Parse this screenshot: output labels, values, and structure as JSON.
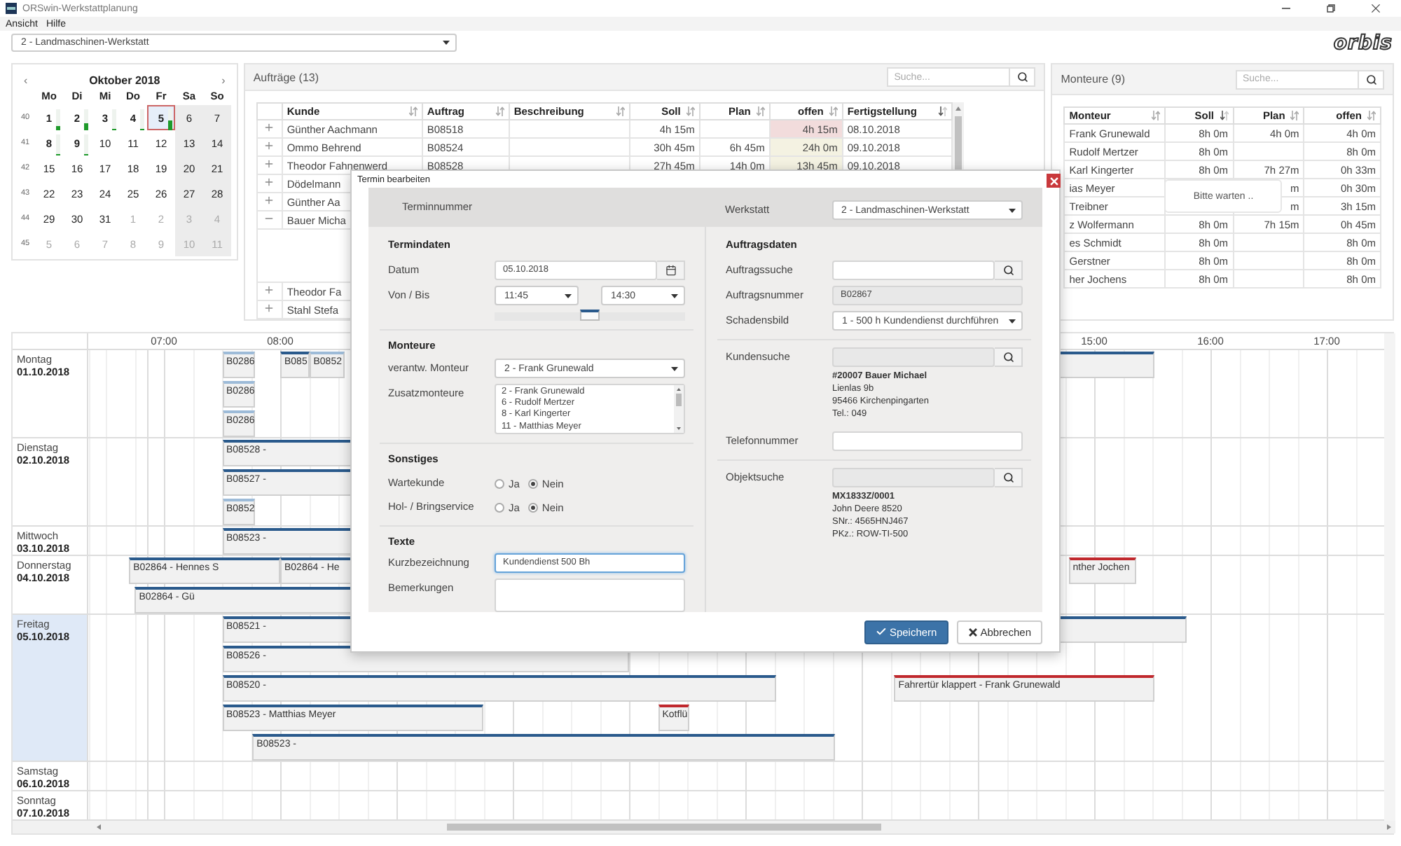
{
  "window": {
    "title": "ORSwin-Werkstattplanung"
  },
  "menu": [
    "Ansicht",
    "Hilfe"
  ],
  "workshop_select": {
    "value": "2 - Landmaschinen-Werkstatt"
  },
  "logo": "orbis",
  "calendar": {
    "prev": "‹",
    "month": "Oktober 2018",
    "next": "›",
    "weekdays": [
      "Mo",
      "Di",
      "Mi",
      "Do",
      "Fr",
      "Sa",
      "So"
    ],
    "weeks": [
      {
        "number": "40",
        "days": [
          {
            "label": "1",
            "muted": false,
            "has_appointments": true,
            "selected": false,
            "level": 0.2
          },
          {
            "label": "2",
            "muted": false,
            "has_appointments": true,
            "selected": false,
            "level": 0.35
          },
          {
            "label": "3",
            "muted": false,
            "has_appointments": true,
            "selected": false,
            "level": 0.07
          },
          {
            "label": "4",
            "muted": false,
            "has_appointments": true,
            "selected": false,
            "level": 0.07
          },
          {
            "label": "5",
            "muted": false,
            "has_appointments": true,
            "selected": true,
            "level": 0.5
          },
          {
            "label": "6",
            "muted": false,
            "has_appointments": false,
            "selected": false
          },
          {
            "label": "7",
            "muted": false,
            "has_appointments": false,
            "selected": false
          }
        ]
      },
      {
        "number": "41",
        "days": [
          {
            "label": "8",
            "muted": false,
            "has_appointments": true,
            "selected": false,
            "level": 0.07
          },
          {
            "label": "9",
            "muted": false,
            "has_appointments": true,
            "selected": false,
            "level": 0.07
          },
          {
            "label": "10",
            "muted": false,
            "has_appointments": false,
            "selected": false
          },
          {
            "label": "11",
            "muted": false,
            "has_appointments": false,
            "selected": false
          },
          {
            "label": "12",
            "muted": false,
            "has_appointments": false,
            "selected": false
          },
          {
            "label": "13",
            "muted": false,
            "has_appointments": false,
            "selected": false
          },
          {
            "label": "14",
            "muted": false,
            "has_appointments": false,
            "selected": false
          }
        ]
      },
      {
        "number": "42",
        "days": [
          {
            "label": "15",
            "muted": false,
            "has_appointments": false,
            "selected": false
          },
          {
            "label": "16",
            "muted": false,
            "has_appointments": false,
            "selected": false
          },
          {
            "label": "17",
            "muted": false,
            "has_appointments": false,
            "selected": false
          },
          {
            "label": "18",
            "muted": false,
            "has_appointments": false,
            "selected": false
          },
          {
            "label": "19",
            "muted": false,
            "has_appointments": false,
            "selected": false
          },
          {
            "label": "20",
            "muted": false,
            "has_appointments": false,
            "selected": false
          },
          {
            "label": "21",
            "muted": false,
            "has_appointments": false,
            "selected": false
          }
        ]
      },
      {
        "number": "43",
        "days": [
          {
            "label": "22",
            "muted": false,
            "has_appointments": false,
            "selected": false
          },
          {
            "label": "23",
            "muted": false,
            "has_appointments": false,
            "selected": false
          },
          {
            "label": "24",
            "muted": false,
            "has_appointments": false,
            "selected": false
          },
          {
            "label": "25",
            "muted": false,
            "has_appointments": false,
            "selected": false
          },
          {
            "label": "26",
            "muted": false,
            "has_appointments": false,
            "selected": false
          },
          {
            "label": "27",
            "muted": false,
            "has_appointments": false,
            "selected": false
          },
          {
            "label": "28",
            "muted": false,
            "has_appointments": false,
            "selected": false
          }
        ]
      },
      {
        "number": "44",
        "days": [
          {
            "label": "29",
            "muted": false,
            "has_appointments": false,
            "selected": false
          },
          {
            "label": "30",
            "muted": false,
            "has_appointments": false,
            "selected": false
          },
          {
            "label": "31",
            "muted": false,
            "has_appointments": false,
            "selected": false
          },
          {
            "label": "1",
            "muted": true,
            "has_appointments": false,
            "selected": false
          },
          {
            "label": "2",
            "muted": true,
            "has_appointments": false,
            "selected": false
          },
          {
            "label": "3",
            "muted": true,
            "has_appointments": false,
            "selected": false
          },
          {
            "label": "4",
            "muted": true,
            "has_appointments": false,
            "selected": false
          }
        ]
      },
      {
        "number": "45",
        "days": [
          {
            "label": "5",
            "muted": true,
            "has_appointments": false,
            "selected": false
          },
          {
            "label": "6",
            "muted": true,
            "has_appointments": false,
            "selected": false
          },
          {
            "label": "7",
            "muted": true,
            "has_appointments": false,
            "selected": false
          },
          {
            "label": "8",
            "muted": true,
            "has_appointments": false,
            "selected": false
          },
          {
            "label": "9",
            "muted": true,
            "has_appointments": false,
            "selected": false
          },
          {
            "label": "10",
            "muted": true,
            "has_appointments": false,
            "selected": false
          },
          {
            "label": "11",
            "muted": true,
            "has_appointments": false,
            "selected": false
          }
        ]
      }
    ]
  },
  "orders": {
    "title": "Aufträge (13)",
    "search_placeholder": "Suche...",
    "columns": [
      {
        "label": "Kunde",
        "sorted": false
      },
      {
        "label": "Auftrag",
        "sorted": false
      },
      {
        "label": "Beschreibung",
        "sorted": false
      },
      {
        "label": "Soll",
        "sorted": false
      },
      {
        "label": "Plan",
        "sorted": false
      },
      {
        "label": "offen",
        "sorted": false
      },
      {
        "label": "Fertigstellung",
        "sorted": true
      }
    ],
    "rows": [
      {
        "expanded": false,
        "color": "#f2dcdc",
        "cells": [
          "Günther Aachmann",
          "B08518",
          null,
          "4h 15m",
          null,
          "4h 15m",
          "08.10.2018"
        ]
      },
      {
        "expanded": false,
        "color": "#f4f2e2",
        "cells": [
          "Ommo Behrend",
          "B08524",
          null,
          "30h 45m",
          "6h 45m",
          "24h 0m",
          "09.10.2018"
        ]
      },
      {
        "expanded": false,
        "color": "#f4f2e2",
        "cells": [
          "Theodor Fahnenwerd",
          "B08528",
          null,
          "27h 45m",
          "14h 0m",
          "13h 45m",
          "09.10.2018"
        ]
      },
      {
        "expanded": false,
        "cells": [
          "Dödelmann"
        ]
      },
      {
        "expanded": false,
        "cells": [
          "Günther Aa"
        ]
      },
      {
        "expanded": true,
        "cells": [
          "Bauer Micha"
        ]
      },
      {
        "expanded": false,
        "cells": [
          "Theodor Fa"
        ]
      },
      {
        "expanded": false,
        "cells": [
          "Stahl Stefa"
        ]
      }
    ]
  },
  "monteure": {
    "title": "Monteure (9)",
    "search_placeholder": "Suche...",
    "busy_message": "Bitte warten ..",
    "columns": [
      {
        "label": "Monteur",
        "sorted": false
      },
      {
        "label": "Soll",
        "sorted": true
      },
      {
        "label": "Plan",
        "sorted": false
      },
      {
        "label": "offen",
        "sorted": false
      }
    ],
    "rows": [
      {
        "cells": [
          "Frank Grunewald",
          "8h 0m",
          "4h 0m",
          "4h 0m"
        ]
      },
      {
        "cells": [
          "Rudolf Mertzer",
          "8h 0m",
          null,
          "8h 0m"
        ]
      },
      {
        "cells": [
          "Karl Kingerter",
          "8h 0m",
          "7h 27m",
          "0h 33m"
        ]
      },
      {
        "cells": [
          "ias Meyer",
          null,
          "m",
          "0h 30m"
        ]
      },
      {
        "cells": [
          "Treibner",
          null,
          "m",
          "3h 15m"
        ]
      },
      {
        "cells": [
          "z Wolfermann",
          "8h 0m",
          "7h 15m",
          "0h 45m"
        ]
      },
      {
        "cells": [
          "es Schmidt",
          "8h 0m",
          null,
          "8h 0m"
        ]
      },
      {
        "cells": [
          "Gerstner",
          "8h 0m",
          null,
          "8h 0m"
        ]
      },
      {
        "cells": [
          "her Jochens",
          "8h 0m",
          null,
          "8h 0m"
        ]
      }
    ]
  },
  "schedule": {
    "time_header": [
      "07:00",
      "08:00",
      "15:00",
      "16:00",
      "17:00"
    ],
    "days": [
      {
        "weekday": "Montag",
        "date": "01.10.2018",
        "selected": false,
        "bars": [
          {
            "label": "B0286",
            "color": "#9dbbd8"
          },
          {
            "label": "B0286",
            "color": "#9dbbd8"
          },
          {
            "label": "B0286",
            "color": "#9dbbd8"
          },
          {
            "label": "B085",
            "color": "#2a5a8c"
          },
          {
            "label": "B0852",
            "color": "#9dbbd8"
          },
          {
            "color": "#2a5a8c"
          }
        ]
      },
      {
        "weekday": "Dienstag",
        "date": "02.10.2018",
        "selected": false,
        "bars": [
          {
            "label": "B08528 -",
            "color": "#2a5a8c"
          },
          {
            "label": "B08527 -",
            "color": "#2a5a8c"
          },
          {
            "label": "B0852",
            "color": "#9dbbd8"
          }
        ]
      },
      {
        "weekday": "Mittwoch",
        "date": "03.10.2018",
        "selected": false,
        "bars": [
          {
            "label": "B08523 -",
            "color": "#2a5a8c"
          }
        ]
      },
      {
        "weekday": "Donnerstag",
        "date": "04.10.2018",
        "selected": false,
        "bars": [
          {
            "label": "B02864 - Hennes S",
            "color": "#2a5a8c"
          },
          {
            "label": "B02864 - He",
            "color": "#2a5a8c"
          },
          {
            "label": "nther Jochen",
            "color": "#c0282d"
          },
          {
            "label": "B02864 - Gü",
            "color": "#2a5a8c"
          }
        ]
      },
      {
        "weekday": "Freitag",
        "date": "05.10.2018",
        "selected": true,
        "bars": [
          {
            "label": "B08521 -",
            "color": "#2a5a8c"
          },
          {
            "label": "B08526 -",
            "color": "#2a5a8c"
          },
          {
            "label": "B08520 -",
            "color": "#2a5a8c"
          },
          {
            "label": "Fahrertür klappert - Frank Grunewald",
            "color": "#c0282d"
          },
          {
            "label": "B08523 - Matthias Meyer",
            "color": "#2a5a8c"
          },
          {
            "label": "Kotflü",
            "color": "#c0282d"
          },
          {
            "label": "B08523 -",
            "color": "#2a5a8c"
          }
        ]
      },
      {
        "weekday": "Samstag",
        "date": "06.10.2018",
        "selected": false
      },
      {
        "weekday": "Sonntag",
        "date": "07.10.2018",
        "selected": false
      }
    ]
  },
  "dialog": {
    "title": "Termin bearbeiten",
    "terminnummer_label": "Terminnummer",
    "werkstatt": {
      "label": "Werkstatt",
      "value": "2 - Landmaschinen-Werkstatt"
    },
    "termindaten": {
      "heading": "Termindaten",
      "datum": {
        "label": "Datum",
        "value": "05.10.2018"
      },
      "zeit": {
        "label": "Von / Bis",
        "von": "11:45",
        "bis": "14:30"
      },
      "slider": {
        "level": 0.5
      }
    },
    "monteure": {
      "heading": "Monteure",
      "verantwortlich": {
        "label": "verantw. Monteur",
        "value": "2 - Frank Grunewald"
      },
      "zusatz": {
        "label": "Zusatzmonteure",
        "options": [
          {
            "label": "2 - Frank Grunewald",
            "selected": false
          },
          {
            "label": "6 - Rudolf Mertzer",
            "selected": false
          },
          {
            "label": "8 - Karl Kingerter",
            "selected": false
          },
          {
            "label": "11 - Matthias Meyer",
            "selected": false
          }
        ]
      }
    },
    "sonstiges": {
      "heading": "Sonstiges",
      "options": [
        {
          "label": "Wartekunde",
          "choices": [
            {
              "label": "Ja",
              "selected": false
            },
            {
              "label": "Nein",
              "selected": true
            }
          ]
        },
        {
          "label": "Hol- / Bringservice",
          "choices": [
            {
              "label": "Ja",
              "selected": false
            },
            {
              "label": "Nein",
              "selected": true
            }
          ]
        }
      ]
    },
    "texte": {
      "heading": "Texte",
      "kurzbezeichnung": {
        "label": "Kurzbezeichnung",
        "value": "Kundendienst 500 Bh",
        "focused": true
      },
      "bemerkungen": {
        "label": "Bemerkungen"
      }
    },
    "auftragsdaten": {
      "heading": "Auftragsdaten",
      "auftragssuche": {
        "label": "Auftragssuche",
        "disabled": false
      },
      "auftragsnummer": {
        "label": "Auftragsnummer",
        "value": "B02867",
        "disabled": true
      },
      "schadensbild": {
        "label": "Schadensbild",
        "value": "1 - 500 h Kundendienst durchführen"
      },
      "kundensuche": {
        "label": "Kundensuche",
        "disabled": true,
        "result": [
          "#20007 Bauer Michael",
          "Lienlas 9b",
          "95466 Kirchenpingarten",
          "Tel.: 049"
        ]
      },
      "telefonnummer": {
        "label": "Telefonnummer",
        "disabled": false
      },
      "objektsuche": {
        "label": "Objektsuche",
        "disabled": true,
        "result": [
          "MX1833Z/0001",
          "John Deere 8520",
          "SNr.: 4565HNJ467",
          "PKz.: ROW-TI-500"
        ]
      }
    },
    "buttons": [
      {
        "label": "Speichern",
        "kind": "primary"
      },
      {
        "label": "Abbrechen",
        "kind": "cancel"
      }
    ]
  }
}
